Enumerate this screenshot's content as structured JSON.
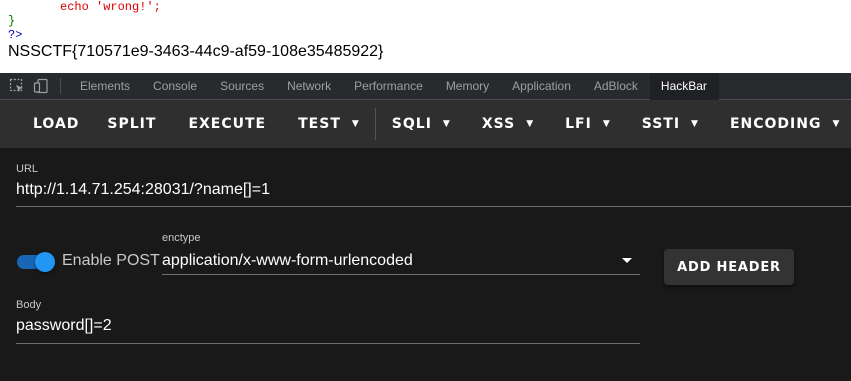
{
  "page": {
    "code_line_1": "echo 'wrong!';",
    "code_line_2": "}",
    "code_line_3": "?>",
    "flag": "NSSCTF{710571e9-3463-44c9-af59-108e35485922}"
  },
  "devtools": {
    "tabs": [
      "Elements",
      "Console",
      "Sources",
      "Network",
      "Performance",
      "Memory",
      "Application",
      "AdBlock",
      "HackBar"
    ],
    "active_tab": "HackBar",
    "icons": [
      "inspect-element-icon",
      "device-toolbar-icon"
    ]
  },
  "hackbar": {
    "toolbar": {
      "load": "LOAD",
      "split": "SPLIT",
      "execute": "EXECUTE",
      "test": "TEST",
      "sqli": "SQLI",
      "xss": "XSS",
      "lfi": "LFI",
      "ssti": "SSTI",
      "encoding": "ENCODING"
    },
    "url_label": "URL",
    "url_value": "http://1.14.71.254:28031/?name[]=1",
    "enable_post_label": "Enable POST",
    "enable_post": true,
    "enctype_label": "enctype",
    "enctype_value": "application/x-www-form-urlencoded",
    "add_header": "ADD HEADER",
    "body_label": "Body",
    "body_value": "password[]=2"
  },
  "colors": {
    "accent": "#2196f3",
    "toolbar_bg": "#2f2f2f",
    "panel_bg": "#191919"
  }
}
